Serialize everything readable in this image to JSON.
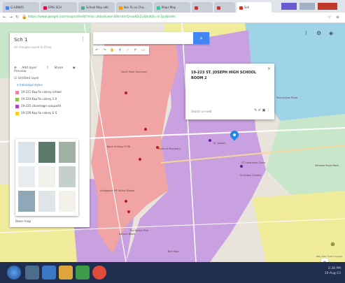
{
  "browser": {
    "tabs": [
      "G ILRNX5",
      "EPIG SCH",
      "School Map edit",
      "Ken FL-ns Cho...",
      "Maps Map",
      "",
      "",
      "Sch"
    ],
    "url": "https://www.google.com/maps/d/edit?mid=zkbo4uwm1BkrotmQvxa82iZuSbcK/b=d 1jv/blsdel"
  },
  "panel": {
    "title": "Sch 1",
    "subtitle": "All changes saved to Drive",
    "actions": [
      "Add layer",
      "Share",
      "Preview"
    ],
    "layer_title": "Untitled layer",
    "layer_style": "Individual styles",
    "items": [
      {
        "label": "19-221 Kap fix colony school",
        "color": "#e68aa0"
      },
      {
        "label": "19-224 Kap fix colony 1.0",
        "color": "#8bc34a"
      },
      {
        "label": "19-225 chandrage voluparth",
        "color": "#ab47bc"
      },
      {
        "label": "19-226 Kap fix colony E-S",
        "color": "#ffca28"
      }
    ],
    "basemap_label": "Base map"
  },
  "infowindow": {
    "title": "19-223 ST. JOSEPH HIGH SCHOOL ROOM 2",
    "link": "Search on web",
    "tools": "✎ ✐ ▣ ⋮"
  },
  "map_labels": [
    "North Point Seminary",
    "Tam-Kalyan Rural",
    "St. Lawrences College",
    "St. Joseph",
    "Sahakar Rural Bank",
    "Bank of Kbay 9736",
    "State of Pharmacy",
    "Srinivasa Cinema",
    "Ambegaon PR Police Station",
    "The Kerala Phar",
    "Bus Stop",
    "Kalyani Block",
    "ST. Lawrence Grace"
  ],
  "footer": "Map data ©2017 Google",
  "clock": {
    "time": "2:38 PM",
    "date": "10-Aug-23"
  },
  "colors": {
    "pink_region": "#f0a4a4",
    "purple_region": "#c9a0e0",
    "yellow_region": "#f1ec9c",
    "blue_region": "#9fd3e8",
    "green_region": "#c8e6c9",
    "pin": "#1e88e5"
  }
}
